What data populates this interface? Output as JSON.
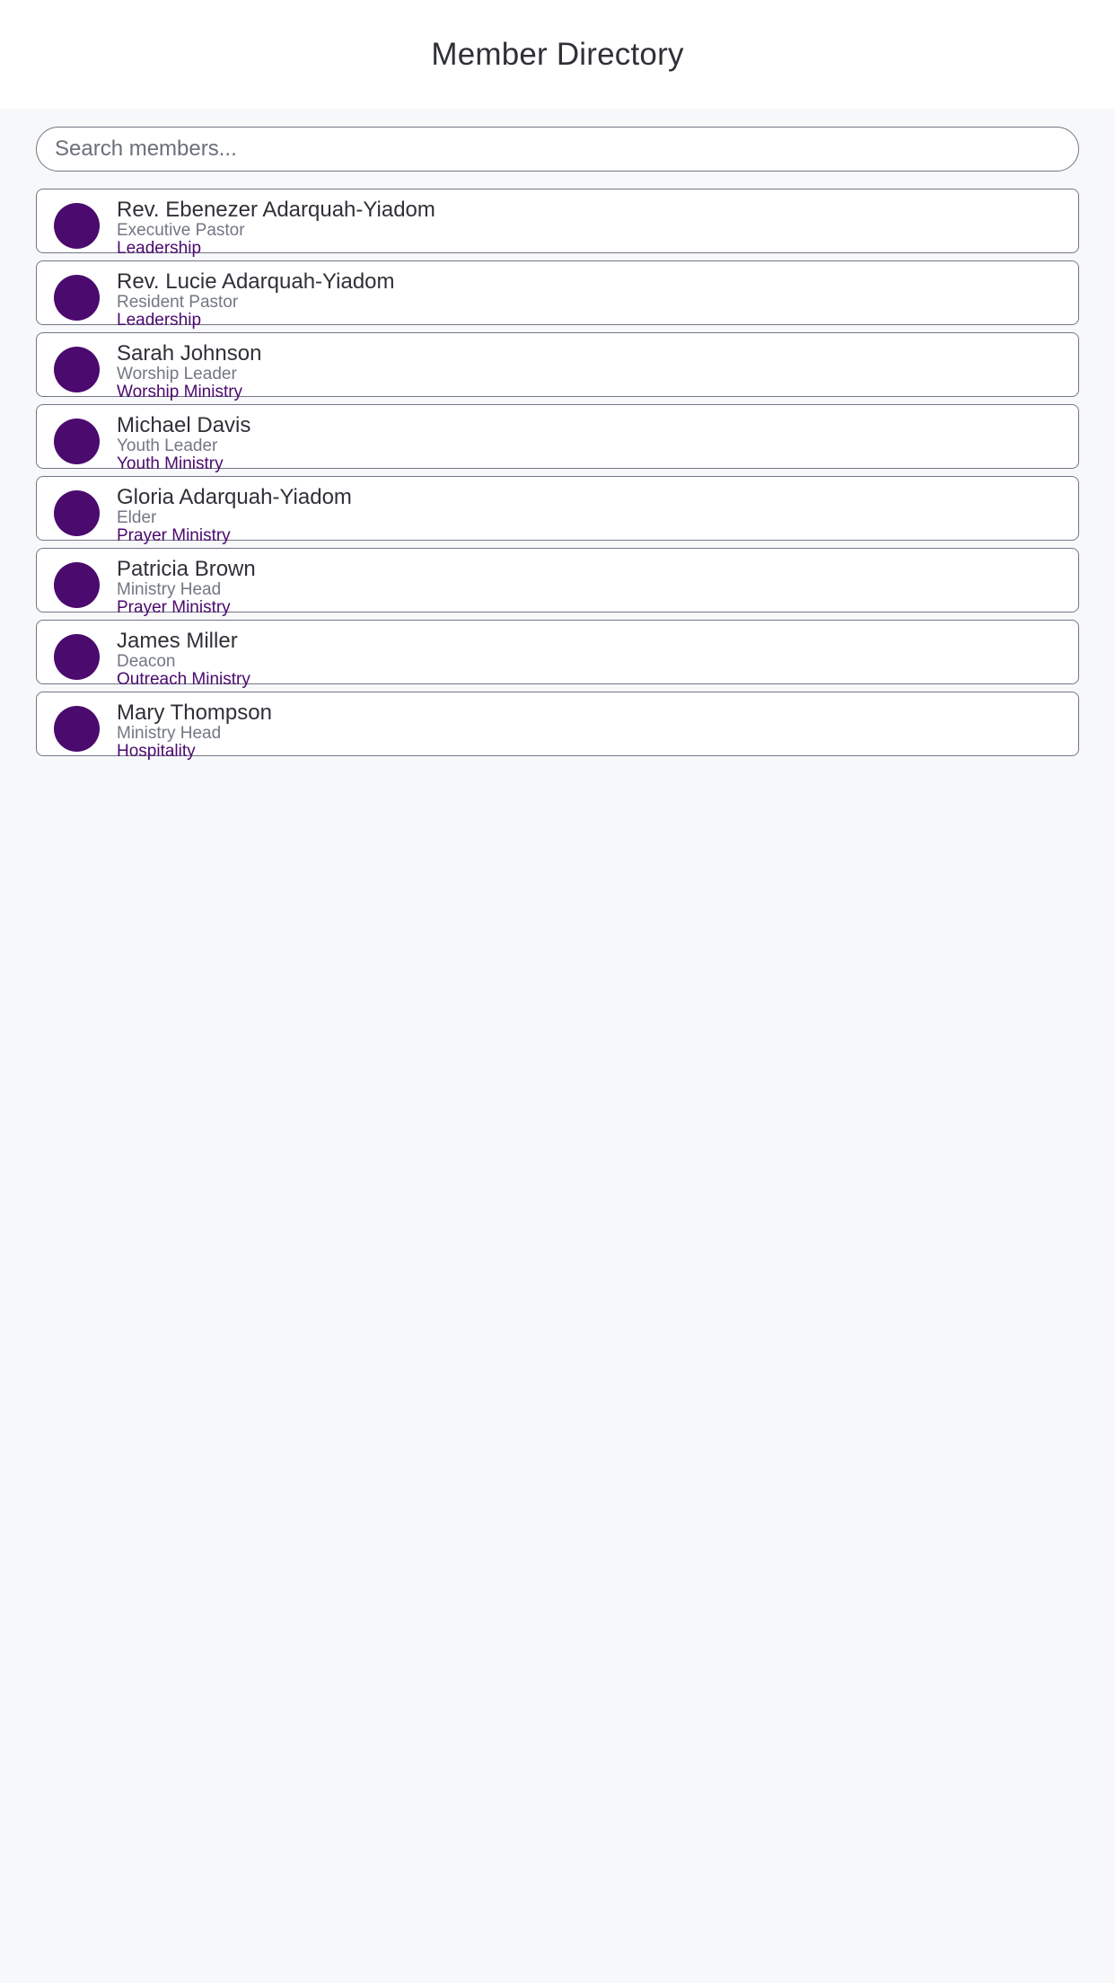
{
  "header": {
    "title": "Member Directory"
  },
  "search": {
    "placeholder": "Search members..."
  },
  "members": [
    {
      "name": "Rev. Ebenezer Adarquah-Yiadom",
      "role": "Executive Pastor",
      "department": "Leadership"
    },
    {
      "name": "Rev. Lucie Adarquah-Yiadom",
      "role": "Resident Pastor",
      "department": "Leadership"
    },
    {
      "name": "Sarah Johnson",
      "role": "Worship Leader",
      "department": "Worship Ministry"
    },
    {
      "name": "Michael Davis",
      "role": "Youth Leader",
      "department": "Youth Ministry"
    },
    {
      "name": "Gloria Adarquah-Yiadom",
      "role": "Elder",
      "department": "Prayer Ministry"
    },
    {
      "name": "Patricia Brown",
      "role": "Ministry Head",
      "department": "Prayer Ministry"
    },
    {
      "name": "James Miller",
      "role": "Deacon",
      "department": "Outreach Ministry"
    },
    {
      "name": "Mary Thompson",
      "role": "Ministry Head",
      "department": "Hospitality"
    }
  ],
  "colors": {
    "accent": "#4b0a6e",
    "background": "#f7f8fa",
    "card_border": "#737784"
  }
}
